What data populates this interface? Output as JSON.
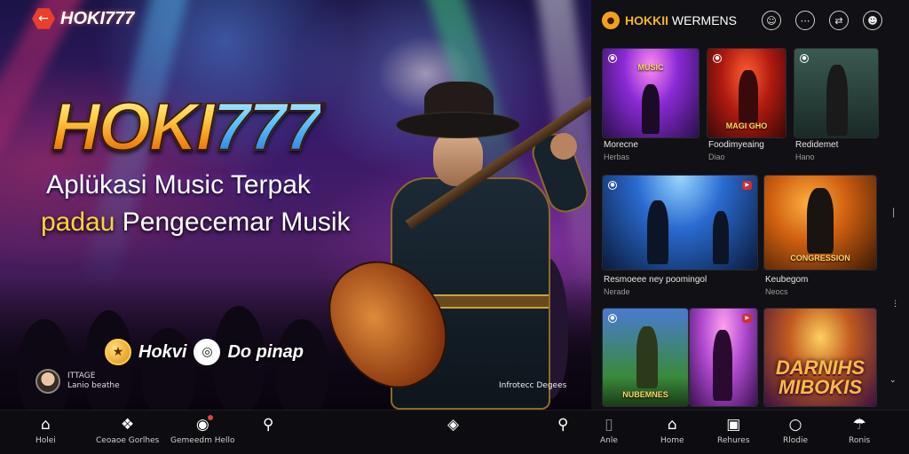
{
  "hero": {
    "brand": {
      "name": "HOKI777",
      "icon": "back-arrow-icon"
    },
    "logo": {
      "word": "HOKI",
      "number": "777"
    },
    "tagline_line1": "Aplükasi Music Terpak",
    "tagline_line2_a": "padau",
    "tagline_line2_b": "Pengecemar Musik",
    "badge": {
      "label_a": "Hokvi",
      "label_b": "Do pinap",
      "icon_a": "gold-medal-icon",
      "icon_b": "disc-icon"
    },
    "profile": {
      "line1": "ITTAGE",
      "line2": "Lanio beathe"
    },
    "note": "Infrotecc Degees"
  },
  "panel": {
    "title_a": "HOKKII",
    "title_b": "WERMENS",
    "header_icons": [
      "avatar-icon",
      "settings-dots-icon",
      "share-icon",
      "profile-icon"
    ],
    "cards": [
      {
        "label": "MUSIC",
        "caption": "Morecne",
        "sub": "Herbas"
      },
      {
        "label": "MAGI GHO",
        "caption": "Foodimyeaing",
        "sub": "Diao"
      },
      {
        "label": "",
        "caption": "Redidemet",
        "sub": "Hano"
      },
      {
        "label": "",
        "caption": "Resmoeee ney poomingol",
        "sub": "Nerade"
      },
      {
        "label": "CONGRESSION",
        "caption": "Keubegom",
        "sub": "Neocs"
      },
      {
        "label": "NUBEMNES",
        "caption": "",
        "sub": ""
      },
      {
        "label": "",
        "caption": "",
        "sub": ""
      },
      {
        "label": "DARNIHS MIBOKIS",
        "caption": "",
        "sub": ""
      }
    ]
  },
  "bottom_nav": {
    "left": [
      {
        "label": "Holei",
        "icon": "home-icon"
      },
      {
        "label": "Ceoaoe Gorlhes",
        "icon": "tag-icon"
      },
      {
        "label": "Gemeedm Hello",
        "icon": "chat-icon"
      },
      {
        "label": "",
        "icon": "search-icon"
      },
      {
        "label": "",
        "icon": "label-icon"
      }
    ],
    "right": [
      {
        "label": "",
        "icon": "search-icon"
      },
      {
        "label": "Anle",
        "icon": "phone-icon"
      },
      {
        "label": "Home",
        "icon": "home-icon"
      },
      {
        "label": "Rehures",
        "icon": "inbox-icon"
      },
      {
        "label": "Rlodie",
        "icon": "circle-icon"
      },
      {
        "label": "Ronis",
        "icon": "shield-icon"
      }
    ]
  }
}
